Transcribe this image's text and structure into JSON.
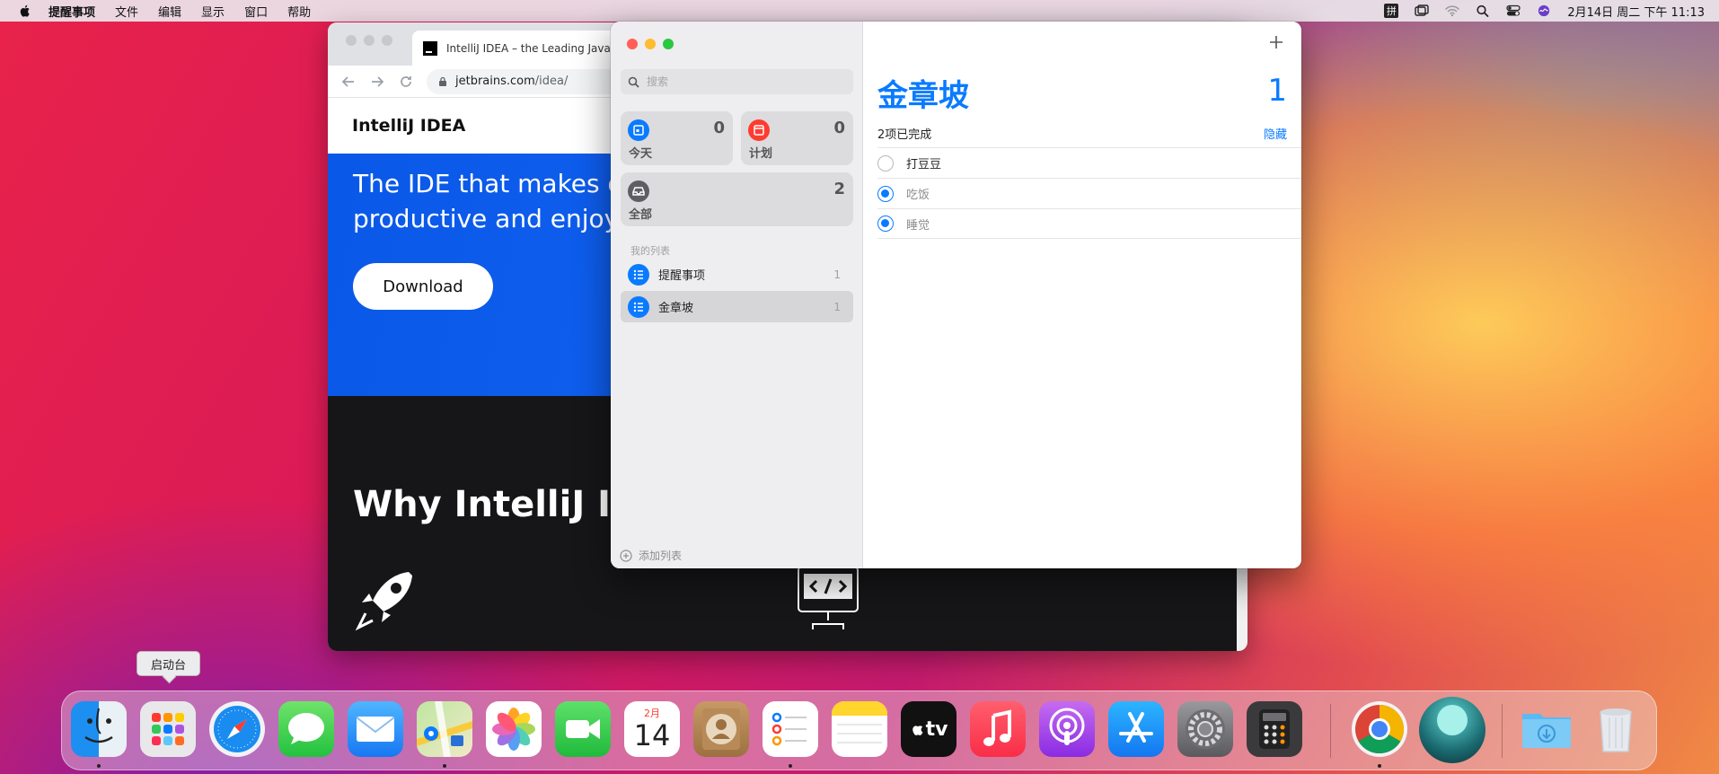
{
  "menubar": {
    "app_name": "提醒事项",
    "items": [
      "文件",
      "编辑",
      "显示",
      "窗口",
      "帮助"
    ],
    "input_method": "拼",
    "clock": "2月14日 周二 下午 11:13"
  },
  "browser": {
    "tab_title": "IntelliJ IDEA – the Leading Java",
    "url_host": "jetbrains.com",
    "url_path": "/idea/",
    "site_name": "IntelliJ IDEA",
    "hero_line1": "The IDE that makes d",
    "hero_line2": "productive and enjoy",
    "download_label": "Download",
    "why_heading": "Why IntelliJ ID"
  },
  "reminders": {
    "search_placeholder": "搜索",
    "smart_lists": {
      "today": {
        "label": "今天",
        "count": "0",
        "color": "#0a7bff"
      },
      "scheduled": {
        "label": "计划",
        "count": "0",
        "color": "#ff3b30"
      },
      "all": {
        "label": "全部",
        "count": "2",
        "color": "#5e5e63"
      }
    },
    "my_lists_title": "我的列表",
    "lists": [
      {
        "name": "提醒事项",
        "count": "1"
      },
      {
        "name": "金章坡",
        "count": "1"
      }
    ],
    "add_list_label": "添加列表",
    "current": {
      "title": "金章坡",
      "count": "1",
      "completed_text": "2项已完成",
      "hide_label": "隐藏",
      "tasks": [
        {
          "name": "打豆豆",
          "done": false
        },
        {
          "name": "吃饭",
          "done": true
        },
        {
          "name": "睡觉",
          "done": true
        }
      ]
    }
  },
  "dock": {
    "tooltip": "启动台",
    "calendar_month": "2月",
    "calendar_day": "14",
    "tv_label": "tv",
    "apps": [
      "finder",
      "launchpad",
      "safari",
      "messages",
      "mail",
      "maps",
      "photos",
      "facetime",
      "calendar",
      "contacts",
      "reminders",
      "notes",
      "apple-tv",
      "music",
      "podcasts",
      "app-store",
      "system-preferences",
      "calculator",
      "chrome",
      "app",
      "downloads",
      "trash"
    ]
  },
  "colors": {
    "accent": "#0a7bff",
    "close": "#ff5f57",
    "minimize": "#febc2e",
    "zoom": "#28c840"
  }
}
